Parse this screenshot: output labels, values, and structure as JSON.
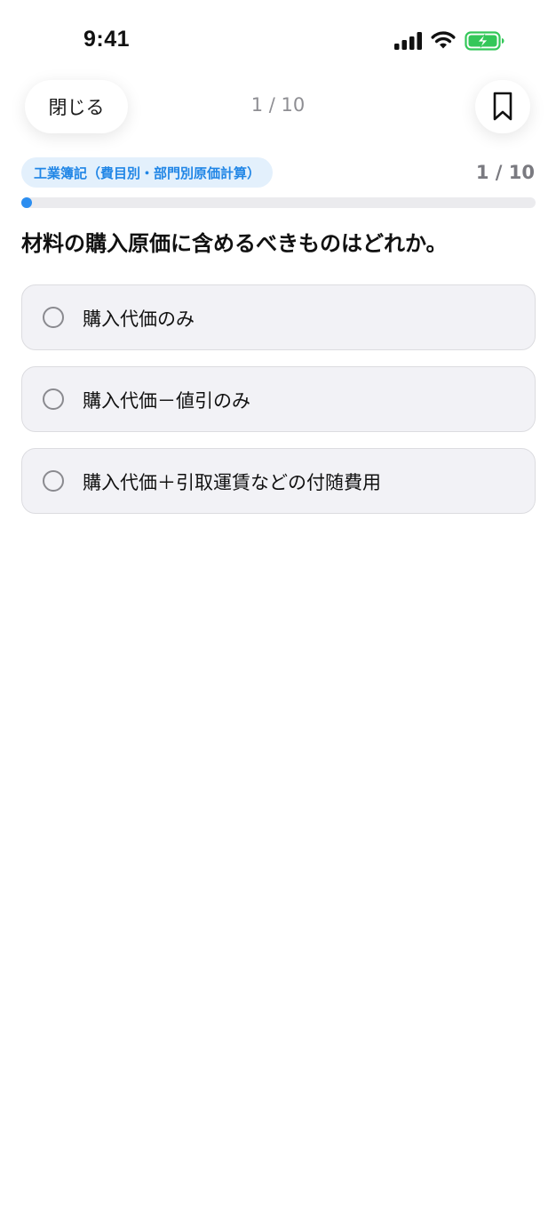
{
  "status_bar": {
    "time": "9:41",
    "signal_icon": "cellular-signal-icon",
    "wifi_icon": "wifi-icon",
    "battery_icon": "battery-charging-icon",
    "battery_color": "#34c759"
  },
  "nav": {
    "close_label": "閉じる",
    "counter": "1 / 10",
    "bookmark_icon": "bookmark-icon"
  },
  "quiz": {
    "category": "工業簿記（費目別・部門別原価計算）",
    "progress_text": "1 / 10",
    "progress_fraction": 0.1,
    "question": "材料の購入原価に含めるべきものはどれか。",
    "options": [
      {
        "label": "購入代価のみ"
      },
      {
        "label": "購入代価－値引のみ"
      },
      {
        "label": "購入代価＋引取運賃などの付随費用"
      }
    ]
  },
  "colors": {
    "accent": "#2c8ef0",
    "badge_bg": "#e3f0fc",
    "badge_text": "#2186e6",
    "option_bg": "#f2f2f6"
  }
}
